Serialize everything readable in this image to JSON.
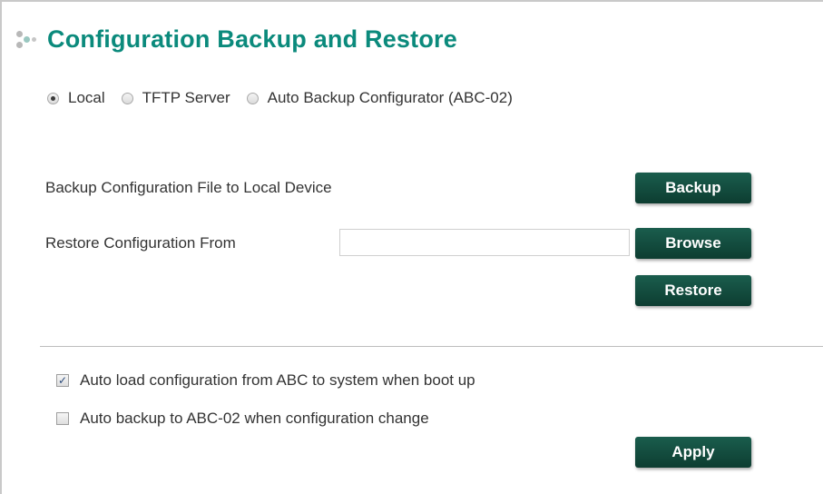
{
  "page": {
    "title": "Configuration Backup and Restore",
    "accent_color": "#0b8a7c",
    "button_color": "#1a5d4d"
  },
  "mode": {
    "options": [
      {
        "label": "Local",
        "checked": true
      },
      {
        "label": "TFTP Server",
        "checked": false
      },
      {
        "label": "Auto Backup Configurator (ABC-02)",
        "checked": false
      }
    ]
  },
  "backup": {
    "label": "Backup Configuration File to Local Device",
    "button": "Backup"
  },
  "restore": {
    "label": "Restore Configuration From",
    "file_value": "",
    "browse_button": "Browse",
    "restore_button": "Restore"
  },
  "options": {
    "auto_load": {
      "label": "Auto load configuration from ABC to system when boot up",
      "checked": true
    },
    "auto_backup": {
      "label": "Auto backup to ABC-02 when configuration change",
      "checked": false
    }
  },
  "apply_button": "Apply"
}
